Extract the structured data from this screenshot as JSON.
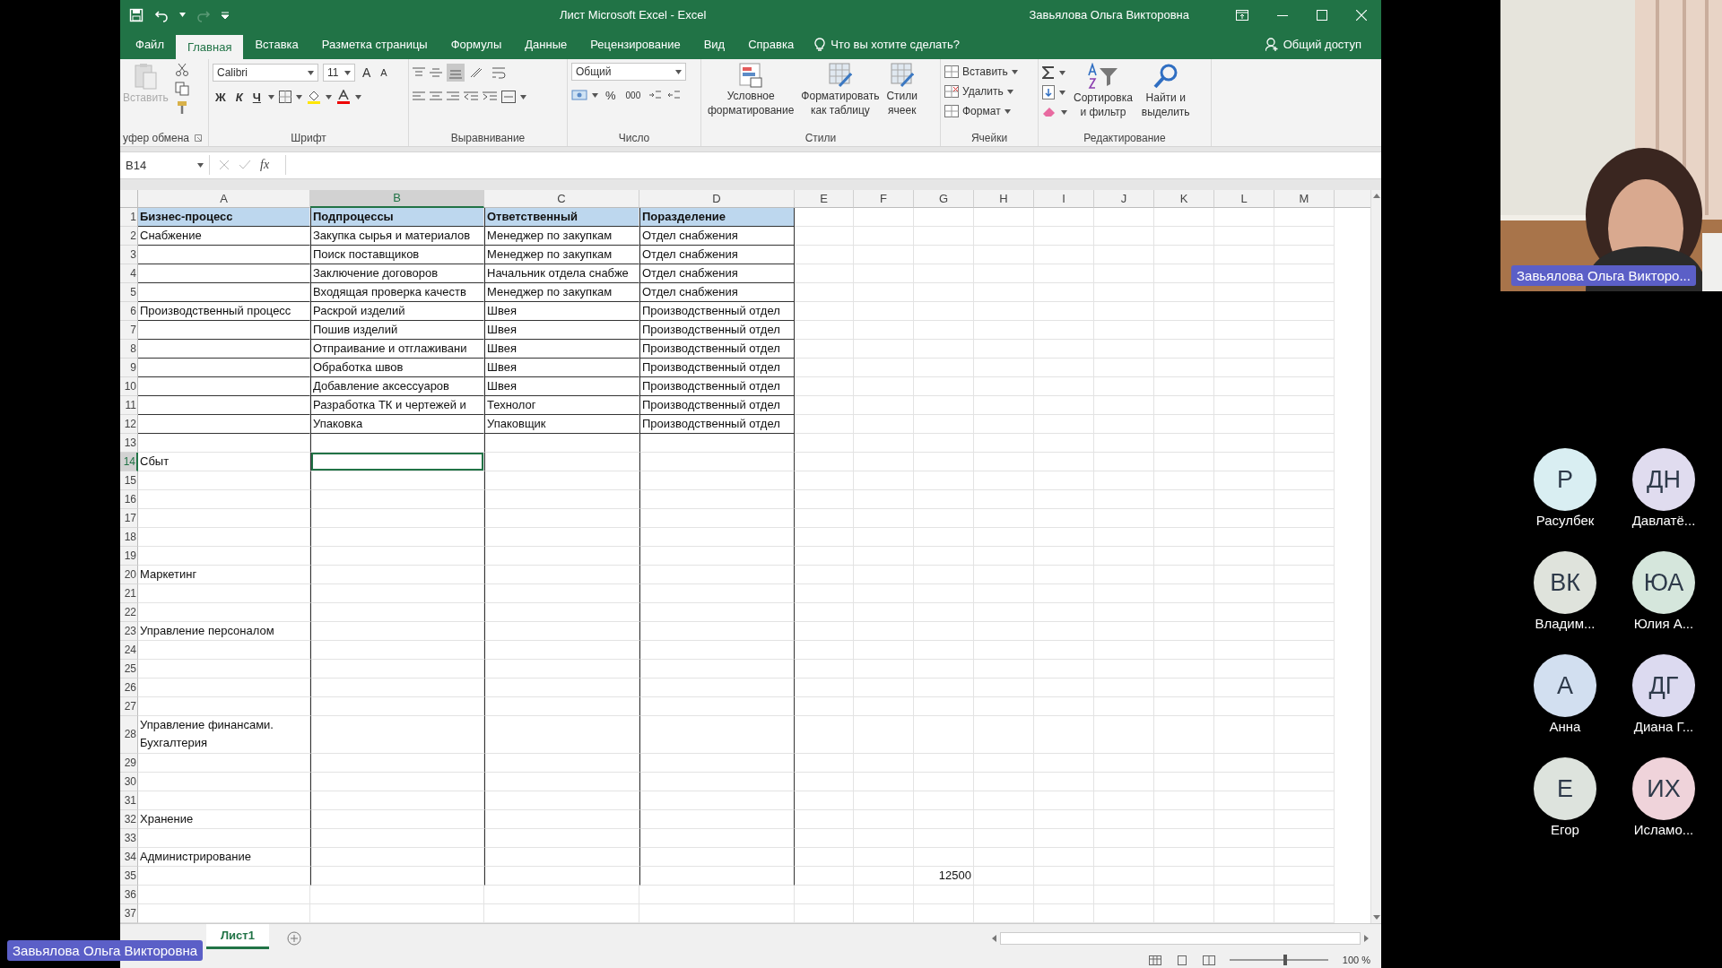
{
  "title_bar": {
    "title": "Лист Microsoft Excel  -  Excel",
    "user": "Завьялова Ольга Викторовна"
  },
  "ribbon_tabs": [
    {
      "label": "Файл",
      "selected": false
    },
    {
      "label": "Главная",
      "selected": true
    },
    {
      "label": "Вставка",
      "selected": false
    },
    {
      "label": "Разметка страницы",
      "selected": false
    },
    {
      "label": "Формулы",
      "selected": false
    },
    {
      "label": "Данные",
      "selected": false
    },
    {
      "label": "Рецензирование",
      "selected": false
    },
    {
      "label": "Вид",
      "selected": false
    },
    {
      "label": "Справка",
      "selected": false
    }
  ],
  "tell_me": {
    "placeholder": "Что вы хотите сделать?"
  },
  "share_button": "Общий доступ",
  "ribbon": {
    "clipboard": {
      "paste": "Вставить",
      "paste_disabled": true,
      "label": "уфер обмена"
    },
    "font": {
      "family": "Calibri",
      "size": "11",
      "grow": "A",
      "shrink": "A",
      "bold": "Ж",
      "italic": "К",
      "underline": "Ч",
      "label": "Шрифт"
    },
    "alignment": {
      "label": "Выравнивание"
    },
    "number": {
      "format": "Общий",
      "percent": "%",
      "thousands": "000",
      "label": "Число"
    },
    "styles": {
      "buttons": [
        {
          "lines": [
            "Условное",
            "форматирование"
          ]
        },
        {
          "lines": [
            "Форматировать",
            "как таблицу"
          ]
        },
        {
          "lines": [
            "Стили",
            "ячеек"
          ]
        }
      ],
      "label": "Стили"
    },
    "cells": {
      "buttons": [
        "Вставить",
        "Удалить",
        "Формат"
      ],
      "label": "Ячейки"
    },
    "editing": {
      "buttons": [
        {
          "lines": [
            "Сортировка",
            "и фильтр"
          ]
        },
        {
          "lines": [
            "Найти и",
            "выделить"
          ]
        }
      ],
      "label": "Редактирование"
    }
  },
  "formula_bar": {
    "name_box": "B14",
    "fx": "fx"
  },
  "sheet": {
    "columns": [
      {
        "label": "A",
        "selected": false
      },
      {
        "label": "B",
        "selected": true
      },
      {
        "label": "C",
        "selected": false
      },
      {
        "label": "D",
        "selected": false
      },
      {
        "label": "E",
        "selected": false
      },
      {
        "label": "F",
        "selected": false
      },
      {
        "label": "G",
        "selected": false
      },
      {
        "label": "H",
        "selected": false
      },
      {
        "label": "I",
        "selected": false
      },
      {
        "label": "J",
        "selected": false
      },
      {
        "label": "K",
        "selected": false
      },
      {
        "label": "L",
        "selected": false
      },
      {
        "label": "M",
        "selected": false
      }
    ],
    "header_row": {
      "number": "1",
      "a": "Бизнес-процесс",
      "b": "Подпроцессы",
      "c": "Ответственный",
      "d": "Поразделение"
    },
    "rows": [
      {
        "number": "2",
        "selected": false,
        "a": "Снабжение",
        "b": "Закупка сырья и материалов",
        "c": "Менеджер по закупкам",
        "d": "Отдел снабжения"
      },
      {
        "number": "3",
        "selected": false,
        "b": "Поиск поставщиков",
        "c": "Менеджер по закупкам",
        "d": "Отдел снабжения"
      },
      {
        "number": "4",
        "selected": false,
        "b": "Заключение договоров",
        "c": "Начальник отдела снабже",
        "d": "Отдел снабжения"
      },
      {
        "number": "5",
        "selected": false,
        "b": "Входящая проверка качеств",
        "c": "Менеджер по закупкам",
        "d": "Отдел снабжения"
      },
      {
        "number": "6",
        "selected": false,
        "a": "Производственный процесс",
        "b": "Раскрой изделий",
        "c": "Швея",
        "d": "Производственный отдел"
      },
      {
        "number": "7",
        "selected": false,
        "b": "Пошив изделий",
        "c": "Швея",
        "d": "Производственный отдел"
      },
      {
        "number": "8",
        "selected": false,
        "b": "Отпраивание и отглаживани",
        "c": "Швея",
        "d": "Производственный отдел"
      },
      {
        "number": "9",
        "selected": false,
        "b": "Обработка швов",
        "c": "Швея",
        "d": "Производственный отдел"
      },
      {
        "number": "10",
        "selected": false,
        "b": "Добавление аксессуаров",
        "c": "Швея",
        "d": "Производственный отдел"
      },
      {
        "number": "11",
        "selected": false,
        "b": "Разработка ТК и чертежей и",
        "c": "Технолог",
        "d": "Производственный отдел"
      },
      {
        "number": "12",
        "selected": false,
        "b": "Упаковка",
        "c": "Упаковщик",
        "d": "Производственный отдел"
      },
      {
        "number": "13",
        "selected": false
      },
      {
        "number": "14",
        "selected": true,
        "a": "Сбыт"
      },
      {
        "number": "15",
        "selected": false
      },
      {
        "number": "16",
        "selected": false
      },
      {
        "number": "17",
        "selected": false
      },
      {
        "number": "18",
        "selected": false
      },
      {
        "number": "19",
        "selected": false
      },
      {
        "number": "20",
        "selected": false,
        "a": "Маркетинг"
      },
      {
        "number": "21",
        "selected": false
      },
      {
        "number": "22",
        "selected": false
      },
      {
        "number": "23",
        "selected": false,
        "a": "Управление персоналом"
      },
      {
        "number": "24",
        "selected": false
      },
      {
        "number": "25",
        "selected": false
      },
      {
        "number": "26",
        "selected": false
      },
      {
        "number": "27",
        "selected": false
      },
      {
        "number": "28",
        "selected": false,
        "a": [
          "Управление финансами.",
          "Бухгалтерия"
        ]
      },
      {
        "number": "29",
        "selected": false
      },
      {
        "number": "30",
        "selected": false
      },
      {
        "number": "31",
        "selected": false
      },
      {
        "number": "32",
        "selected": false,
        "a": "Хранение"
      },
      {
        "number": "33",
        "selected": false
      },
      {
        "number": "34",
        "selected": false,
        "a": "Администрирование"
      },
      {
        "number": "35",
        "selected": false,
        "g": "12500"
      },
      {
        "number": "36",
        "selected": false
      },
      {
        "number": "37",
        "selected": false
      }
    ]
  },
  "sheet_tabs": [
    {
      "label": "Лист1",
      "selected": true
    }
  ],
  "status_bar": {
    "zoom": "100 %",
    "level": 0.55
  },
  "presenter": {
    "kind": "picture",
    "name": "Завьялова Ольга Викторо..."
  },
  "participants": [
    {
      "initials": "Р",
      "name": "Расулбек",
      "color": "#d9eef2"
    },
    {
      "initials": "ДН",
      "name": "Давлатё...",
      "color": "#e0dcef"
    },
    {
      "initials": "ВК",
      "name": "Владим...",
      "color": "#dfe3dc"
    },
    {
      "initials": "ЮА",
      "name": "Юлия А...",
      "color": "#d5e6dc"
    },
    {
      "initials": "А",
      "name": "Анна",
      "color": "#d2dff0"
    },
    {
      "initials": "ДГ",
      "name": "Диана Г...",
      "color": "#dcdaf0"
    },
    {
      "initials": "Е",
      "name": "Егор",
      "color": "#dde3dd"
    },
    {
      "initials": "ИХ",
      "name": "Исламо...",
      "color": "#efd3da"
    }
  ],
  "speaker_tag": "Завьялова Ольга Викторовна"
}
